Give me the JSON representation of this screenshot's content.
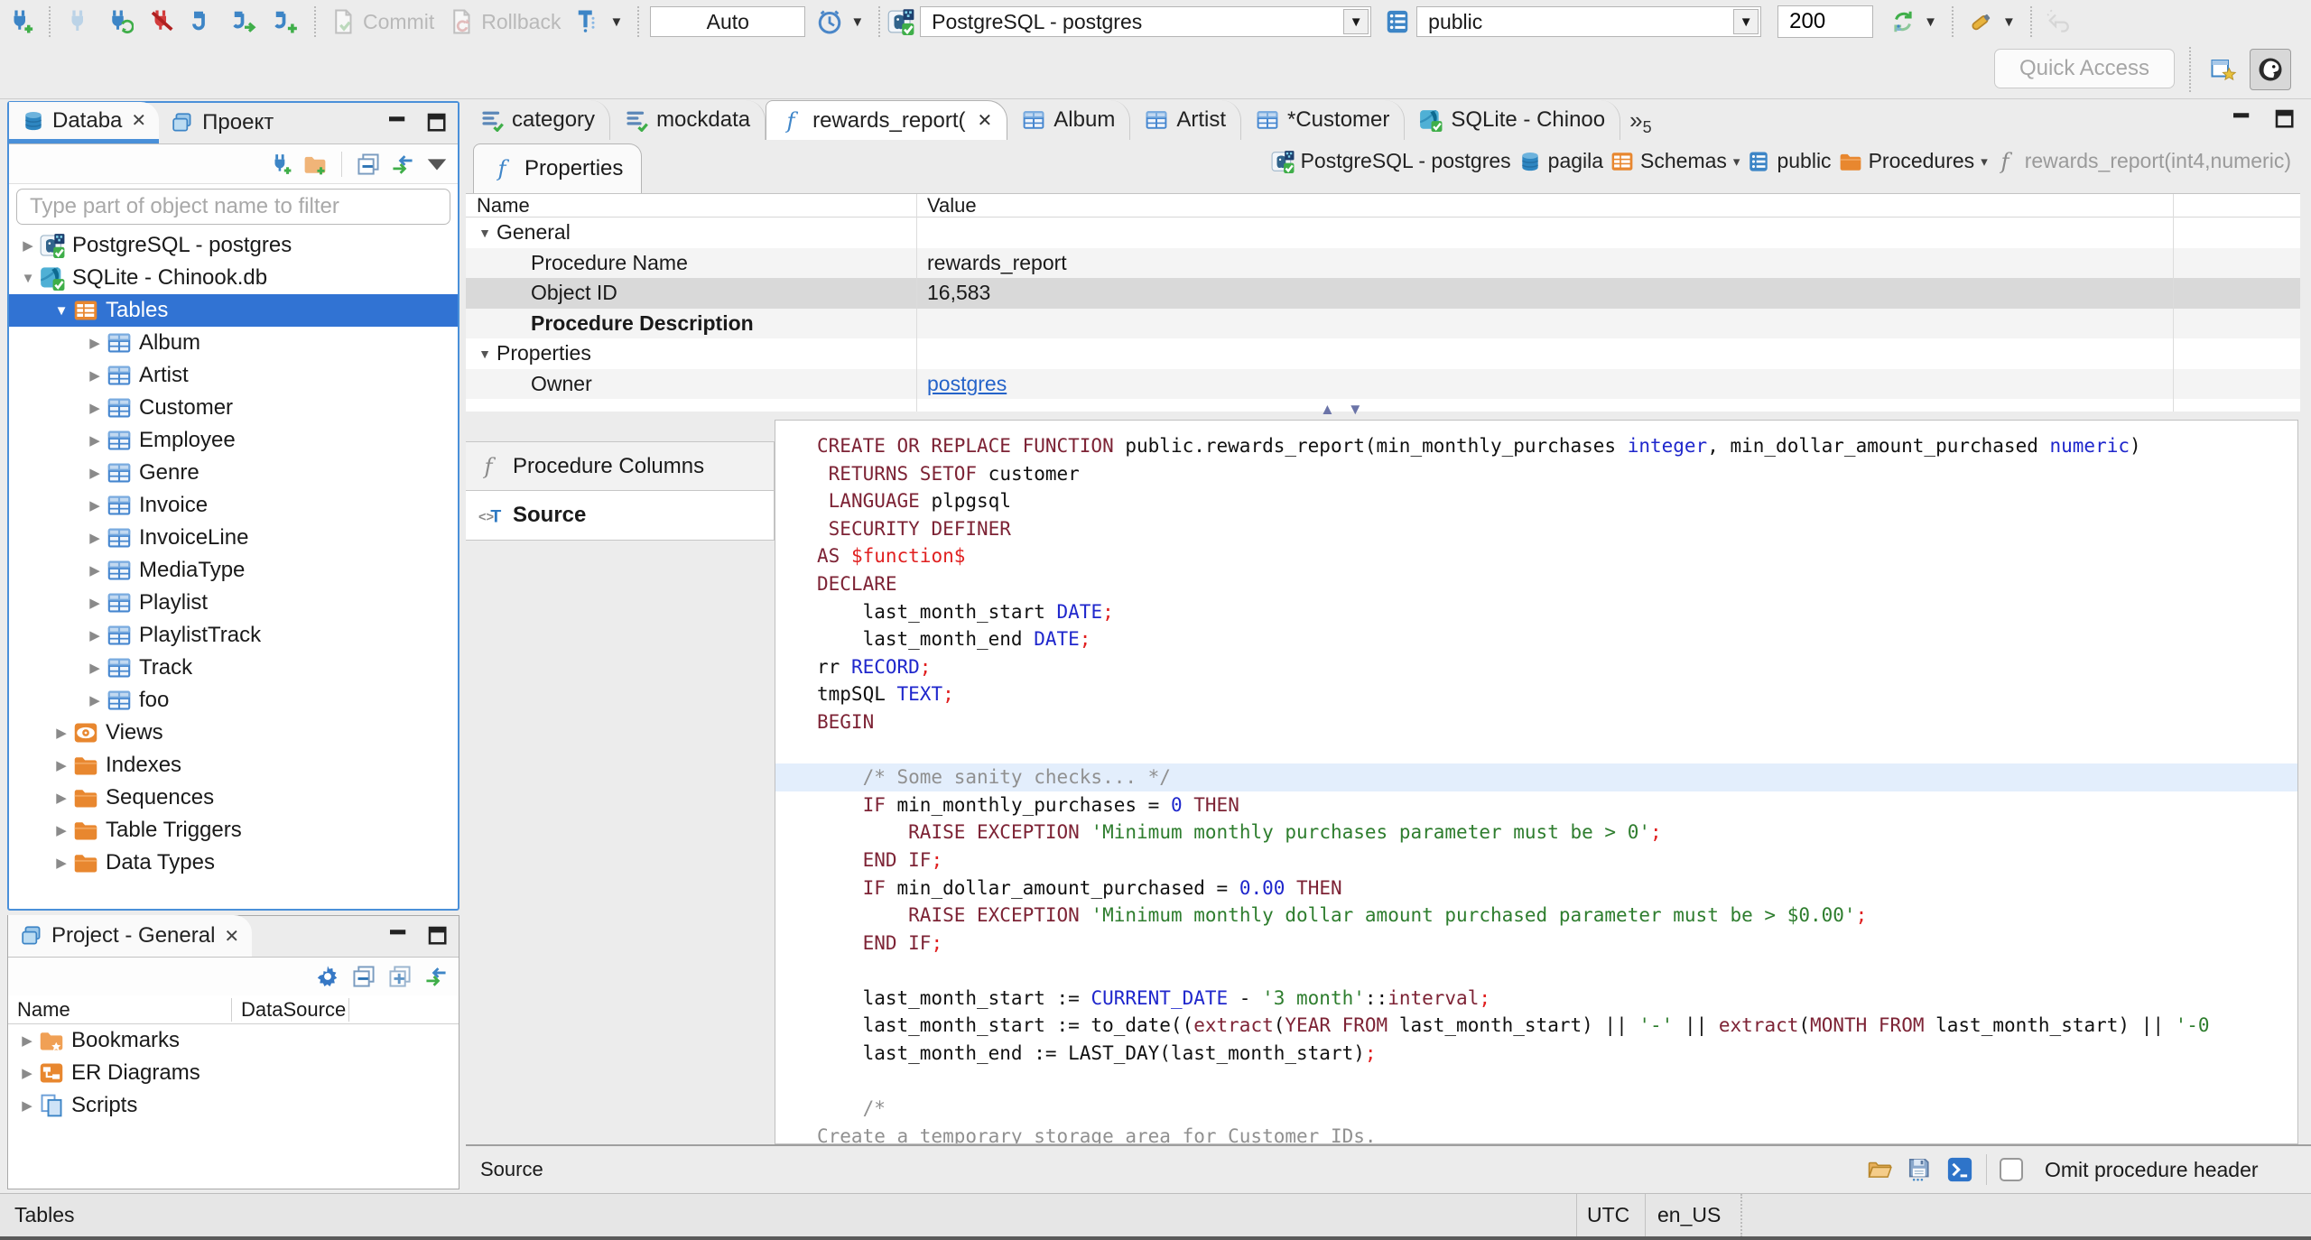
{
  "toolbar": {
    "commit_label": "Commit",
    "rollback_label": "Rollback",
    "auto_value": "Auto",
    "connection_value": "PostgreSQL - postgres",
    "schema_value": "public",
    "fetch_size_value": "200",
    "quick_access_label": "Quick Access"
  },
  "navigator": {
    "tab_database": "Databa",
    "tab_project": "Проект",
    "filter_placeholder": "Type part of object name to filter",
    "tree": [
      {
        "label": "PostgreSQL - postgres",
        "icon": "postgresql",
        "level": 0,
        "arrow": "r"
      },
      {
        "label": "SQLite - Chinook.db",
        "icon": "sqlite",
        "level": 0,
        "arrow": "d"
      },
      {
        "label": "Tables",
        "icon": "tables-folder",
        "level": 1,
        "arrow": "d",
        "selected": true
      },
      {
        "label": "Album",
        "icon": "table",
        "level": 2,
        "arrow": "r"
      },
      {
        "label": "Artist",
        "icon": "table",
        "level": 2,
        "arrow": "r"
      },
      {
        "label": "Customer",
        "icon": "table",
        "level": 2,
        "arrow": "r"
      },
      {
        "label": "Employee",
        "icon": "table",
        "level": 2,
        "arrow": "r"
      },
      {
        "label": "Genre",
        "icon": "table",
        "level": 2,
        "arrow": "r"
      },
      {
        "label": "Invoice",
        "icon": "table",
        "level": 2,
        "arrow": "r"
      },
      {
        "label": "InvoiceLine",
        "icon": "table",
        "level": 2,
        "arrow": "r"
      },
      {
        "label": "MediaType",
        "icon": "table",
        "level": 2,
        "arrow": "r"
      },
      {
        "label": "Playlist",
        "icon": "table",
        "level": 2,
        "arrow": "r"
      },
      {
        "label": "PlaylistTrack",
        "icon": "table",
        "level": 2,
        "arrow": "r"
      },
      {
        "label": "Track",
        "icon": "table",
        "level": 2,
        "arrow": "r"
      },
      {
        "label": "foo",
        "icon": "table",
        "level": 2,
        "arrow": "r"
      },
      {
        "label": "Views",
        "icon": "views",
        "level": 1,
        "arrow": "r"
      },
      {
        "label": "Indexes",
        "icon": "folder",
        "level": 1,
        "arrow": "r"
      },
      {
        "label": "Sequences",
        "icon": "folder",
        "level": 1,
        "arrow": "r"
      },
      {
        "label": "Table Triggers",
        "icon": "folder",
        "level": 1,
        "arrow": "r"
      },
      {
        "label": "Data Types",
        "icon": "folder",
        "level": 1,
        "arrow": "r"
      }
    ]
  },
  "project_panel": {
    "title": "Project - General",
    "columns": [
      "Name",
      "DataSource"
    ],
    "items": [
      {
        "label": "Bookmarks",
        "icon": "folder-star"
      },
      {
        "label": "ER Diagrams",
        "icon": "er-diagram"
      },
      {
        "label": "Scripts",
        "icon": "scripts"
      }
    ]
  },
  "editor_tabs": [
    {
      "label": "category",
      "icon": "sql-script"
    },
    {
      "label": "mockdata",
      "icon": "sql-script"
    },
    {
      "label": "rewards_report(",
      "icon": "function-blue",
      "active": true,
      "closable": true
    },
    {
      "label": "Album",
      "icon": "table"
    },
    {
      "label": "Artist",
      "icon": "table"
    },
    {
      "label": "*Customer",
      "icon": "table"
    },
    {
      "label": "SQLite - Chinoo",
      "icon": "sqlite"
    }
  ],
  "tab_overflow_count": "5",
  "properties_view": {
    "tab_label": "Properties",
    "breadcrumb": [
      {
        "label": "PostgreSQL - postgres",
        "icon": "postgresql"
      },
      {
        "label": "pagila",
        "icon": "db-cylinder"
      },
      {
        "label": "Schemas",
        "icon": "tables-folder",
        "dropdown": true
      },
      {
        "label": "public",
        "icon": "schema"
      },
      {
        "label": "Procedures",
        "icon": "folder",
        "dropdown": true
      },
      {
        "label": "rewards_report(int4,numeric)",
        "icon": "function-gray",
        "dim": true
      }
    ],
    "grid_columns": [
      "Name",
      "Value"
    ],
    "grid_rows": [
      {
        "name": "General",
        "value": "",
        "group": true
      },
      {
        "name": "Procedure Name",
        "value": "rewards_report",
        "stripe": true
      },
      {
        "name": "Object ID",
        "value": "16,583",
        "selected": true
      },
      {
        "name": "Procedure Description",
        "value": "",
        "bold": true,
        "stripe": true
      },
      {
        "name": "Properties",
        "value": "",
        "group": true
      },
      {
        "name": "Owner",
        "value": "postgres",
        "link": true,
        "stripe": true
      }
    ],
    "subtabs": [
      {
        "label": "Procedure Columns",
        "icon": "function-gray"
      },
      {
        "label": "Source",
        "icon": "source",
        "active": true
      }
    ]
  },
  "source_code": {
    "lines": [
      {
        "tokens": [
          [
            "kw",
            "CREATE OR REPLACE FUNCTION"
          ],
          [
            "pl",
            " public.rewards_report(min_monthly_purchases "
          ],
          [
            "ty",
            "integer"
          ],
          [
            "pl",
            ", min_dollar_amount_purchased "
          ],
          [
            "ty",
            "numeric"
          ],
          [
            "pl",
            ")"
          ]
        ]
      },
      {
        "tokens": [
          [
            "pl",
            " "
          ],
          [
            "kw",
            "RETURNS SETOF"
          ],
          [
            "pl",
            " customer"
          ]
        ]
      },
      {
        "tokens": [
          [
            "pl",
            " "
          ],
          [
            "kw",
            "LANGUAGE"
          ],
          [
            "pl",
            " plpgsql"
          ]
        ]
      },
      {
        "tokens": [
          [
            "pl",
            " "
          ],
          [
            "kw",
            "SECURITY DEFINER"
          ]
        ]
      },
      {
        "tokens": [
          [
            "kw",
            "AS"
          ],
          [
            "re",
            " $function$"
          ]
        ]
      },
      {
        "tokens": [
          [
            "kw",
            "DECLARE"
          ]
        ]
      },
      {
        "tokens": [
          [
            "pl",
            "    last_month_start "
          ],
          [
            "ty",
            "DATE"
          ],
          [
            "re",
            ";"
          ]
        ]
      },
      {
        "tokens": [
          [
            "pl",
            "    last_month_end "
          ],
          [
            "ty",
            "DATE"
          ],
          [
            "re",
            ";"
          ]
        ]
      },
      {
        "tokens": [
          [
            "pl",
            "rr "
          ],
          [
            "ty",
            "RECORD"
          ],
          [
            "re",
            ";"
          ]
        ]
      },
      {
        "tokens": [
          [
            "pl",
            "tmpSQL "
          ],
          [
            "ty",
            "TEXT"
          ],
          [
            "re",
            ";"
          ]
        ]
      },
      {
        "tokens": [
          [
            "kw",
            "BEGIN"
          ]
        ]
      },
      {
        "tokens": []
      },
      {
        "highlight": true,
        "tokens": [
          [
            "cm",
            "    /* Some sanity checks... */"
          ]
        ]
      },
      {
        "tokens": [
          [
            "pl",
            "    "
          ],
          [
            "kw",
            "IF"
          ],
          [
            "pl",
            " min_monthly_purchases = "
          ],
          [
            "nu",
            "0"
          ],
          [
            "pl",
            " "
          ],
          [
            "kw",
            "THEN"
          ]
        ]
      },
      {
        "tokens": [
          [
            "pl",
            "        "
          ],
          [
            "kw",
            "RAISE EXCEPTION"
          ],
          [
            "pl",
            " "
          ],
          [
            "st",
            "'Minimum monthly purchases parameter must be > 0'"
          ],
          [
            "re",
            ";"
          ]
        ]
      },
      {
        "tokens": [
          [
            "pl",
            "    "
          ],
          [
            "kw",
            "END IF"
          ],
          [
            "re",
            ";"
          ]
        ]
      },
      {
        "tokens": [
          [
            "pl",
            "    "
          ],
          [
            "kw",
            "IF"
          ],
          [
            "pl",
            " min_dollar_amount_purchased = "
          ],
          [
            "nu",
            "0.00"
          ],
          [
            "pl",
            " "
          ],
          [
            "kw",
            "THEN"
          ]
        ]
      },
      {
        "tokens": [
          [
            "pl",
            "        "
          ],
          [
            "kw",
            "RAISE EXCEPTION"
          ],
          [
            "pl",
            " "
          ],
          [
            "st",
            "'Minimum monthly dollar amount purchased parameter must be > $0.00'"
          ],
          [
            "re",
            ";"
          ]
        ]
      },
      {
        "tokens": [
          [
            "pl",
            "    "
          ],
          [
            "kw",
            "END IF"
          ],
          [
            "re",
            ";"
          ]
        ]
      },
      {
        "tokens": []
      },
      {
        "tokens": [
          [
            "pl",
            "    last_month_start := "
          ],
          [
            "ty",
            "CURRENT_DATE"
          ],
          [
            "pl",
            " - "
          ],
          [
            "st",
            "'3 month'"
          ],
          [
            "pl",
            "::"
          ],
          [
            "kw",
            "interval"
          ],
          [
            "re",
            ";"
          ]
        ]
      },
      {
        "tokens": [
          [
            "pl",
            "    last_month_start := to_date(("
          ],
          [
            "kw",
            "extract"
          ],
          [
            "pl",
            "("
          ],
          [
            "kw",
            "YEAR FROM"
          ],
          [
            "pl",
            " last_month_start) || "
          ],
          [
            "st",
            "'-'"
          ],
          [
            "pl",
            " || "
          ],
          [
            "kw",
            "extract"
          ],
          [
            "pl",
            "("
          ],
          [
            "kw",
            "MONTH FROM"
          ],
          [
            "pl",
            " last_month_start) || "
          ],
          [
            "st",
            "'-0"
          ]
        ]
      },
      {
        "tokens": [
          [
            "pl",
            "    last_month_end := LAST_DAY(last_month_start)"
          ],
          [
            "re",
            ";"
          ]
        ]
      },
      {
        "tokens": []
      },
      {
        "tokens": [
          [
            "cm",
            "    /*"
          ]
        ]
      },
      {
        "tokens": [
          [
            "cm",
            "Create a temporary storage area for Customer IDs."
          ]
        ]
      },
      {
        "tokens": [
          [
            "cm",
            "*/"
          ]
        ]
      }
    ]
  },
  "editor_footer": {
    "label": "Source",
    "omit_checkbox_label": "Omit procedure header"
  },
  "status_bar": {
    "left": "Tables",
    "timezone": "UTC",
    "locale": "en_US"
  }
}
